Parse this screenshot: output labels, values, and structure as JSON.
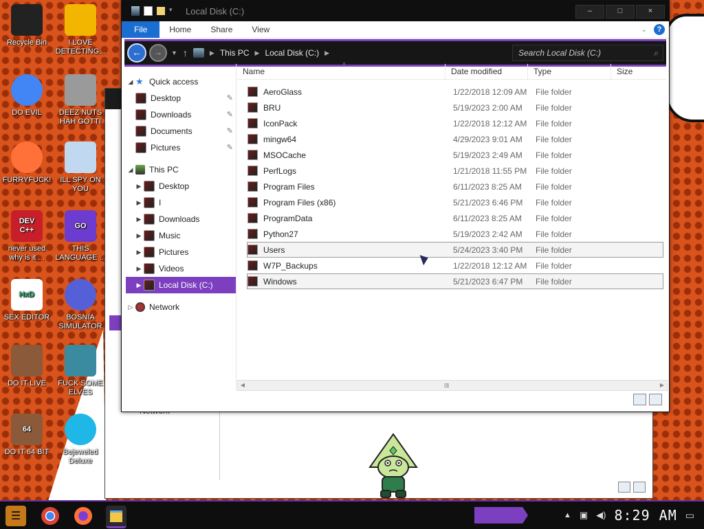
{
  "desktop": {
    "icons": [
      {
        "label": "Recycle Bin",
        "icon": "recycle-bin-icon",
        "color": "#222222"
      },
      {
        "label": "I LOVE DETECTING...",
        "icon": "detect-it-easy-icon",
        "color": "#f2b600"
      },
      {
        "label": "DO EVIL",
        "icon": "chrome-icon",
        "color": "#4285f4"
      },
      {
        "label": "DEEZ NUTS HAH GOTTI",
        "icon": "windows-stack-icon",
        "color": "#9a9a9a"
      },
      {
        "label": "FURRYFUCK!",
        "icon": "firefox-icon",
        "color": "#ff7139"
      },
      {
        "label": "ILL SPY ON YOU",
        "icon": "spy-camera-icon",
        "color": "#c0d8f0"
      },
      {
        "label": "never used why is it ...",
        "icon": "dev-cpp-icon",
        "color": "#c81e2a"
      },
      {
        "label": "THIS LANGUAGE ...",
        "icon": "goland-icon",
        "color": "#6c3bd0"
      },
      {
        "label": "SEX EDITOR",
        "icon": "hxd-editor-icon",
        "color": "#ffffff"
      },
      {
        "label": "BOSNIA SIMULATOR",
        "icon": "mine-icon",
        "color": "#5560d8"
      },
      {
        "label": "DO IT LIVE",
        "icon": "portrait-icon",
        "color": "#8a5a3a"
      },
      {
        "label": "FUCK SOME ELVES",
        "icon": "elf-santa-icon",
        "color": "#3a8aa0"
      },
      {
        "label": "DO IT 64 BIT",
        "icon": "portrait-64-icon",
        "color": "#8a5a3a"
      },
      {
        "label": "Bejeweled Deluxe",
        "icon": "diamond-icon",
        "color": "#1fb6e8"
      }
    ],
    "icon_badges": {
      "dev_cpp": "DEV C++",
      "goland": "GO",
      "hxd": "HxD",
      "bit64": "64"
    }
  },
  "background_window": {
    "network_label": "Network"
  },
  "window": {
    "title": "Local Disk (C:)",
    "controls": {
      "minimize": "–",
      "maximize": "□",
      "close": "×"
    },
    "ribbon": {
      "tabs": [
        "File",
        "Home",
        "Share",
        "View"
      ],
      "help": "?"
    },
    "address": {
      "segments": [
        "This PC",
        "Local Disk (C:)"
      ]
    },
    "search": {
      "placeholder": "Search Local Disk (C:)"
    },
    "nav_pane": {
      "quick_access": "Quick access",
      "quick_items": [
        "Desktop",
        "Downloads",
        "Documents",
        "Pictures"
      ],
      "this_pc": "This PC",
      "pc_items": [
        "Desktop",
        "I",
        "Downloads",
        "Music",
        "Pictures",
        "Videos",
        "Local Disk (C:)"
      ],
      "network": "Network"
    },
    "columns": {
      "name": "Name",
      "date": "Date modified",
      "type": "Type",
      "size": "Size"
    },
    "files": [
      {
        "name": "AeroGlass",
        "date": "1/22/2018 12:09 AM",
        "type": "File folder"
      },
      {
        "name": "BRU",
        "date": "5/19/2023 2:00 AM",
        "type": "File folder"
      },
      {
        "name": "IconPack",
        "date": "1/22/2018 12:12 AM",
        "type": "File folder"
      },
      {
        "name": "mingw64",
        "date": "4/29/2023 9:01 AM",
        "type": "File folder"
      },
      {
        "name": "MSOCache",
        "date": "5/19/2023 2:49 AM",
        "type": "File folder"
      },
      {
        "name": "PerfLogs",
        "date": "1/21/2018 11:55 PM",
        "type": "File folder"
      },
      {
        "name": "Program Files",
        "date": "6/11/2023 8:25 AM",
        "type": "File folder"
      },
      {
        "name": "Program Files (x86)",
        "date": "5/21/2023 6:46 PM",
        "type": "File folder"
      },
      {
        "name": "ProgramData",
        "date": "6/11/2023 8:25 AM",
        "type": "File folder"
      },
      {
        "name": "Python27",
        "date": "5/19/2023 2:42 AM",
        "type": "File folder"
      },
      {
        "name": "Users",
        "date": "5/24/2023 3:40 PM",
        "type": "File folder"
      },
      {
        "name": "W7P_Backups",
        "date": "1/22/2018 12:12 AM",
        "type": "File folder"
      },
      {
        "name": "Windows",
        "date": "5/21/2023 6:47 PM",
        "type": "File folder"
      }
    ]
  },
  "taskbar": {
    "clock": "8:29 AM"
  },
  "colors": {
    "accent_purple": "#7b3fc0",
    "file_tab_blue": "#1b6ed1",
    "desktop_orange": "#d9531c"
  }
}
